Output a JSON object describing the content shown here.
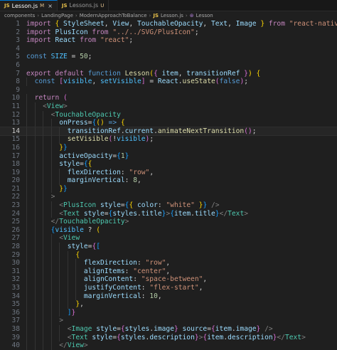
{
  "tabs": [
    {
      "name": "Lesson.js",
      "badge": "M",
      "active": true,
      "close": "×"
    },
    {
      "name": "Lessons.js",
      "badge": "U",
      "active": false
    }
  ],
  "breadcrumb": [
    "components",
    "LandingPage",
    "ModernApproachToBalance",
    "Lesson.js",
    "Lesson"
  ],
  "lines": [
    {
      "n": 1,
      "indent": 0,
      "tokens": [
        [
          "kw",
          "import "
        ],
        [
          "br1",
          "{ "
        ],
        [
          "id",
          "StyleSheet"
        ],
        [
          "tx",
          ", "
        ],
        [
          "id",
          "View"
        ],
        [
          "tx",
          ", "
        ],
        [
          "id",
          "TouchableOpacity"
        ],
        [
          "tx",
          ", "
        ],
        [
          "id",
          "Text"
        ],
        [
          "tx",
          ", "
        ],
        [
          "id",
          "Image "
        ],
        [
          "br1",
          "}"
        ],
        [
          "kw",
          " from "
        ],
        [
          "st",
          "\"react-native\""
        ],
        [
          "tx",
          ";"
        ]
      ]
    },
    {
      "n": 2,
      "indent": 0,
      "tokens": [
        [
          "kw",
          "import "
        ],
        [
          "id",
          "PlusIcon"
        ],
        [
          "kw",
          " from "
        ],
        [
          "st",
          "\"../../SVG/PlusIcon\""
        ],
        [
          "tx",
          ";"
        ]
      ]
    },
    {
      "n": 3,
      "indent": 0,
      "tokens": [
        [
          "kw",
          "import "
        ],
        [
          "id",
          "React"
        ],
        [
          "kw",
          " from "
        ],
        [
          "st",
          "\"react\""
        ],
        [
          "tx",
          ";"
        ]
      ]
    },
    {
      "n": 4,
      "indent": 0,
      "tokens": []
    },
    {
      "n": 5,
      "indent": 0,
      "tokens": [
        [
          "sk",
          "const "
        ],
        [
          "co",
          "SIZE"
        ],
        [
          "tx",
          " = "
        ],
        [
          "nm",
          "50"
        ],
        [
          "tx",
          ";"
        ]
      ]
    },
    {
      "n": 6,
      "indent": 0,
      "tokens": []
    },
    {
      "n": 7,
      "indent": 0,
      "tokens": [
        [
          "kw",
          "export default "
        ],
        [
          "sk",
          "function "
        ],
        [
          "fn",
          "Lesson"
        ],
        [
          "br1",
          "("
        ],
        [
          "br2",
          "{ "
        ],
        [
          "id",
          "item"
        ],
        [
          "tx",
          ", "
        ],
        [
          "id",
          "transitionRef "
        ],
        [
          "br2",
          "}"
        ],
        [
          "br1",
          ")"
        ],
        [
          "tx",
          " "
        ],
        [
          "br1",
          "{"
        ]
      ]
    },
    {
      "n": 8,
      "indent": 1,
      "tokens": [
        [
          "sk",
          "const "
        ],
        [
          "br2",
          "["
        ],
        [
          "co",
          "visible"
        ],
        [
          "tx",
          ", "
        ],
        [
          "co",
          "setVisible"
        ],
        [
          "br2",
          "]"
        ],
        [
          "tx",
          " = "
        ],
        [
          "id",
          "React"
        ],
        [
          "tx",
          "."
        ],
        [
          "fn",
          "useState"
        ],
        [
          "br2",
          "("
        ],
        [
          "sk",
          "false"
        ],
        [
          "br2",
          ")"
        ],
        [
          "tx",
          ";"
        ]
      ]
    },
    {
      "n": 9,
      "indent": 0,
      "tokens": []
    },
    {
      "n": 10,
      "indent": 1,
      "tokens": [
        [
          "kw",
          "return "
        ],
        [
          "br2",
          "("
        ]
      ]
    },
    {
      "n": 11,
      "indent": 2,
      "tokens": [
        [
          "pn",
          "<"
        ],
        [
          "tg",
          "View"
        ],
        [
          "pn",
          ">"
        ]
      ]
    },
    {
      "n": 12,
      "indent": 3,
      "tokens": [
        [
          "pn",
          "<"
        ],
        [
          "tg",
          "TouchableOpacity"
        ]
      ]
    },
    {
      "n": 13,
      "indent": 4,
      "tokens": [
        [
          "at",
          "onPress"
        ],
        [
          "tx",
          "="
        ],
        [
          "br3",
          "{"
        ],
        [
          "br1",
          "()"
        ],
        [
          "sk",
          " => "
        ],
        [
          "br1",
          "{"
        ]
      ]
    },
    {
      "n": 14,
      "indent": 5,
      "current": true,
      "tokens": [
        [
          "id",
          "transitionRef"
        ],
        [
          "tx",
          "."
        ],
        [
          "id",
          "current"
        ],
        [
          "tx",
          "."
        ],
        [
          "fn",
          "animateNextTransition"
        ],
        [
          "br2",
          "()"
        ],
        [
          "tx",
          ";"
        ]
      ]
    },
    {
      "n": 15,
      "indent": 5,
      "tokens": [
        [
          "fn",
          "setVisible"
        ],
        [
          "br2",
          "("
        ],
        [
          "tx",
          "!"
        ],
        [
          "co",
          "visible"
        ],
        [
          "br2",
          ")"
        ],
        [
          "tx",
          ";"
        ]
      ]
    },
    {
      "n": 16,
      "indent": 4,
      "tokens": [
        [
          "br1",
          "}"
        ],
        [
          "br3",
          "}"
        ]
      ]
    },
    {
      "n": 17,
      "indent": 4,
      "tokens": [
        [
          "at",
          "activeOpacity"
        ],
        [
          "tx",
          "="
        ],
        [
          "br3",
          "{"
        ],
        [
          "nm",
          "1"
        ],
        [
          "br3",
          "}"
        ]
      ]
    },
    {
      "n": 18,
      "indent": 4,
      "tokens": [
        [
          "at",
          "style"
        ],
        [
          "tx",
          "="
        ],
        [
          "br3",
          "{"
        ],
        [
          "br1",
          "{"
        ]
      ]
    },
    {
      "n": 19,
      "indent": 5,
      "tokens": [
        [
          "id",
          "flexDirection"
        ],
        [
          "tx",
          ": "
        ],
        [
          "st",
          "\"row\""
        ],
        [
          "tx",
          ","
        ]
      ]
    },
    {
      "n": 20,
      "indent": 5,
      "tokens": [
        [
          "id",
          "marginVertical"
        ],
        [
          "tx",
          ": "
        ],
        [
          "nm",
          "8"
        ],
        [
          "tx",
          ","
        ]
      ]
    },
    {
      "n": 21,
      "indent": 4,
      "tokens": [
        [
          "br1",
          "}"
        ],
        [
          "br3",
          "}"
        ]
      ]
    },
    {
      "n": 22,
      "indent": 3,
      "tokens": [
        [
          "pn",
          ">"
        ]
      ]
    },
    {
      "n": 23,
      "indent": 4,
      "tokens": [
        [
          "pn",
          "<"
        ],
        [
          "tg",
          "PlusIcon"
        ],
        [
          "at",
          " style"
        ],
        [
          "tx",
          "="
        ],
        [
          "br3",
          "{"
        ],
        [
          "br1",
          "{ "
        ],
        [
          "id",
          "color"
        ],
        [
          "tx",
          ": "
        ],
        [
          "st",
          "\"white\""
        ],
        [
          "br1",
          " }"
        ],
        [
          "br3",
          "}"
        ],
        [
          "pn",
          " />"
        ]
      ]
    },
    {
      "n": 24,
      "indent": 4,
      "tokens": [
        [
          "pn",
          "<"
        ],
        [
          "tg",
          "Text"
        ],
        [
          "at",
          " style"
        ],
        [
          "tx",
          "="
        ],
        [
          "br3",
          "{"
        ],
        [
          "id",
          "styles"
        ],
        [
          "tx",
          "."
        ],
        [
          "id",
          "title"
        ],
        [
          "br3",
          "}"
        ],
        [
          "pn",
          ">"
        ],
        [
          "br3",
          "{"
        ],
        [
          "id",
          "item"
        ],
        [
          "tx",
          "."
        ],
        [
          "id",
          "title"
        ],
        [
          "br3",
          "}"
        ],
        [
          "pn",
          "</"
        ],
        [
          "tg",
          "Text"
        ],
        [
          "pn",
          ">"
        ]
      ]
    },
    {
      "n": 25,
      "indent": 3,
      "tokens": [
        [
          "pn",
          "</"
        ],
        [
          "tg",
          "TouchableOpacity"
        ],
        [
          "pn",
          ">"
        ]
      ]
    },
    {
      "n": 26,
      "indent": 3,
      "tokens": [
        [
          "br3",
          "{"
        ],
        [
          "co",
          "visible"
        ],
        [
          "tx",
          " ? "
        ],
        [
          "br1",
          "("
        ]
      ]
    },
    {
      "n": 27,
      "indent": 4,
      "tokens": [
        [
          "pn",
          "<"
        ],
        [
          "tg",
          "View"
        ]
      ]
    },
    {
      "n": 28,
      "indent": 5,
      "tokens": [
        [
          "at",
          "style"
        ],
        [
          "tx",
          "="
        ],
        [
          "br2",
          "{"
        ],
        [
          "br3",
          "["
        ]
      ]
    },
    {
      "n": 29,
      "indent": 6,
      "tokens": [
        [
          "br1",
          "{"
        ]
      ]
    },
    {
      "n": 30,
      "indent": 7,
      "tokens": [
        [
          "id",
          "flexDirection"
        ],
        [
          "tx",
          ": "
        ],
        [
          "st",
          "\"row\""
        ],
        [
          "tx",
          ","
        ]
      ]
    },
    {
      "n": 31,
      "indent": 7,
      "tokens": [
        [
          "id",
          "alignItems"
        ],
        [
          "tx",
          ": "
        ],
        [
          "st",
          "\"center\""
        ],
        [
          "tx",
          ","
        ]
      ]
    },
    {
      "n": 32,
      "indent": 7,
      "tokens": [
        [
          "id",
          "alignContent"
        ],
        [
          "tx",
          ": "
        ],
        [
          "st",
          "\"space-between\""
        ],
        [
          "tx",
          ","
        ]
      ]
    },
    {
      "n": 33,
      "indent": 7,
      "tokens": [
        [
          "id",
          "justifyContent"
        ],
        [
          "tx",
          ": "
        ],
        [
          "st",
          "\"flex-start\""
        ],
        [
          "tx",
          ","
        ]
      ]
    },
    {
      "n": 34,
      "indent": 7,
      "tokens": [
        [
          "id",
          "marginVertical"
        ],
        [
          "tx",
          ": "
        ],
        [
          "nm",
          "10"
        ],
        [
          "tx",
          ","
        ]
      ]
    },
    {
      "n": 35,
      "indent": 6,
      "tokens": [
        [
          "br1",
          "}"
        ],
        [
          "tx",
          ","
        ]
      ]
    },
    {
      "n": 36,
      "indent": 5,
      "tokens": [
        [
          "br3",
          "]"
        ],
        [
          "br2",
          "}"
        ]
      ]
    },
    {
      "n": 37,
      "indent": 4,
      "tokens": [
        [
          "pn",
          ">"
        ]
      ]
    },
    {
      "n": 38,
      "indent": 5,
      "tokens": [
        [
          "pn",
          "<"
        ],
        [
          "tg",
          "Image"
        ],
        [
          "at",
          " style"
        ],
        [
          "tx",
          "="
        ],
        [
          "br2",
          "{"
        ],
        [
          "id",
          "styles"
        ],
        [
          "tx",
          "."
        ],
        [
          "id",
          "image"
        ],
        [
          "br2",
          "}"
        ],
        [
          "at",
          " source"
        ],
        [
          "tx",
          "="
        ],
        [
          "br2",
          "{"
        ],
        [
          "id",
          "item"
        ],
        [
          "tx",
          "."
        ],
        [
          "id",
          "image"
        ],
        [
          "br2",
          "}"
        ],
        [
          "pn",
          " />"
        ]
      ]
    },
    {
      "n": 39,
      "indent": 5,
      "tokens": [
        [
          "pn",
          "<"
        ],
        [
          "tg",
          "Text"
        ],
        [
          "at",
          " style"
        ],
        [
          "tx",
          "="
        ],
        [
          "br2",
          "{"
        ],
        [
          "id",
          "styles"
        ],
        [
          "tx",
          "."
        ],
        [
          "id",
          "description"
        ],
        [
          "br2",
          "}"
        ],
        [
          "pn",
          ">"
        ],
        [
          "br2",
          "{"
        ],
        [
          "id",
          "item"
        ],
        [
          "tx",
          "."
        ],
        [
          "id",
          "description"
        ],
        [
          "br2",
          "}"
        ],
        [
          "pn",
          "</"
        ],
        [
          "tg",
          "Text"
        ],
        [
          "pn",
          ">"
        ]
      ]
    },
    {
      "n": 40,
      "indent": 4,
      "tokens": [
        [
          "pn",
          "</"
        ],
        [
          "tg",
          "View"
        ],
        [
          "pn",
          ">"
        ]
      ]
    }
  ]
}
